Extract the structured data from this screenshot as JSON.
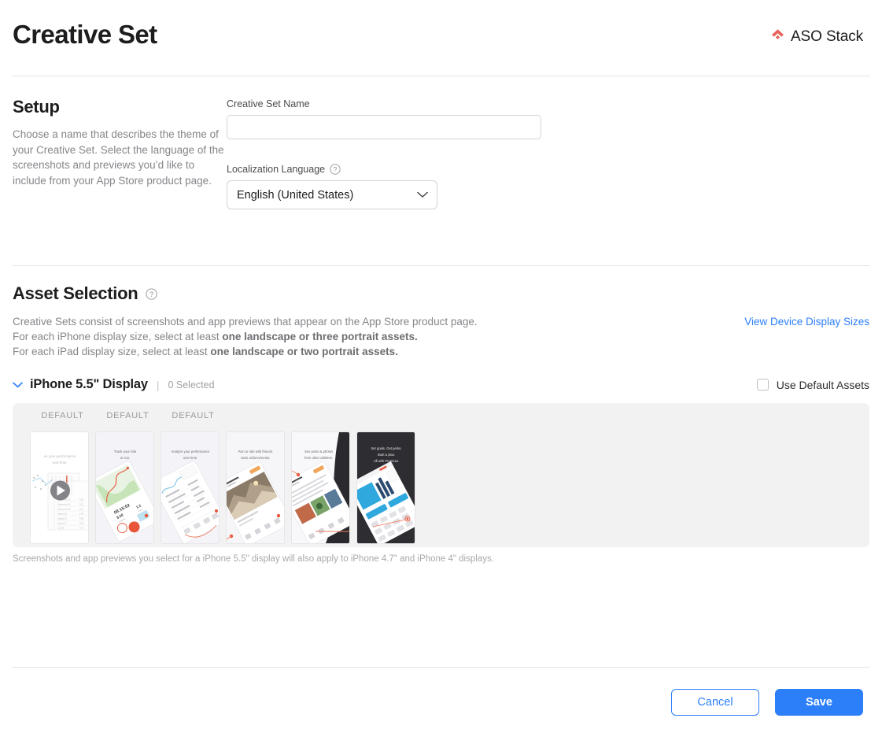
{
  "header": {
    "title": "Creative Set",
    "brand_name": "ASO Stack",
    "brand_icon": "aso-stack-logo-icon",
    "brand_color": "#e8635a"
  },
  "setup": {
    "heading": "Setup",
    "description": "Choose a name that describes the theme of your Creative Set. Select the language of the screenshots and previews you’d like to include from your App Store product page.",
    "name_field": {
      "label": "Creative Set Name",
      "value": "",
      "placeholder": ""
    },
    "language_field": {
      "label": "Localization Language",
      "help_icon": "question-circle-icon",
      "selected": "English (United States)",
      "options": [
        "English (United States)"
      ],
      "chevron_icon": "chevron-down-icon"
    }
  },
  "assets": {
    "heading": "Asset Selection",
    "help_icon": "question-circle-icon",
    "rules": [
      {
        "text": "Creative Sets consist of screenshots and app previews that appear on the App Store product page.",
        "bold": ""
      },
      {
        "text": "For each iPhone display size, select at least ",
        "bold": "one landscape or three portrait assets."
      },
      {
        "text": "For each iPad display size, select at least ",
        "bold": "one landscape or two portrait assets."
      }
    ],
    "device_link": "View Device Display Sizes",
    "display_group": {
      "disclosure_icon": "chevron-down-icon",
      "name": "iPhone 5.5\" Display",
      "separator": "|",
      "selected_count": "0 Selected"
    },
    "use_default": {
      "label": "Use Default Assets",
      "checked": false
    },
    "gallery": {
      "default_labels": [
        "DEFAULT",
        "DEFAULT",
        "DEFAULT"
      ],
      "thumbnails": [
        {
          "kind": "app-preview-video",
          "caption": "See your performance over time.",
          "theme": "light",
          "play_icon": "play-button-icon"
        },
        {
          "kind": "screenshot",
          "caption": "Track your ride or run.",
          "theme": "light"
        },
        {
          "kind": "screenshot",
          "caption": "Analyze your performance over time.",
          "theme": "light"
        },
        {
          "kind": "screenshot",
          "caption": "Run or ride with friends. Earn achievements.",
          "theme": "light"
        },
        {
          "kind": "screenshot",
          "caption": "See posts & photos from other athletes.",
          "theme": "light"
        },
        {
          "kind": "screenshot",
          "caption": "Set goals. Get perks. Start a plan. All with Premium.",
          "theme": "dark"
        }
      ]
    },
    "note": "Screenshots and app previews you select for a iPhone 5.5\" display will also apply to iPhone 4.7\" and iPhone 4\" displays."
  },
  "footer": {
    "cancel_label": "Cancel",
    "save_label": "Save",
    "accent_color": "#2d7ff9"
  }
}
